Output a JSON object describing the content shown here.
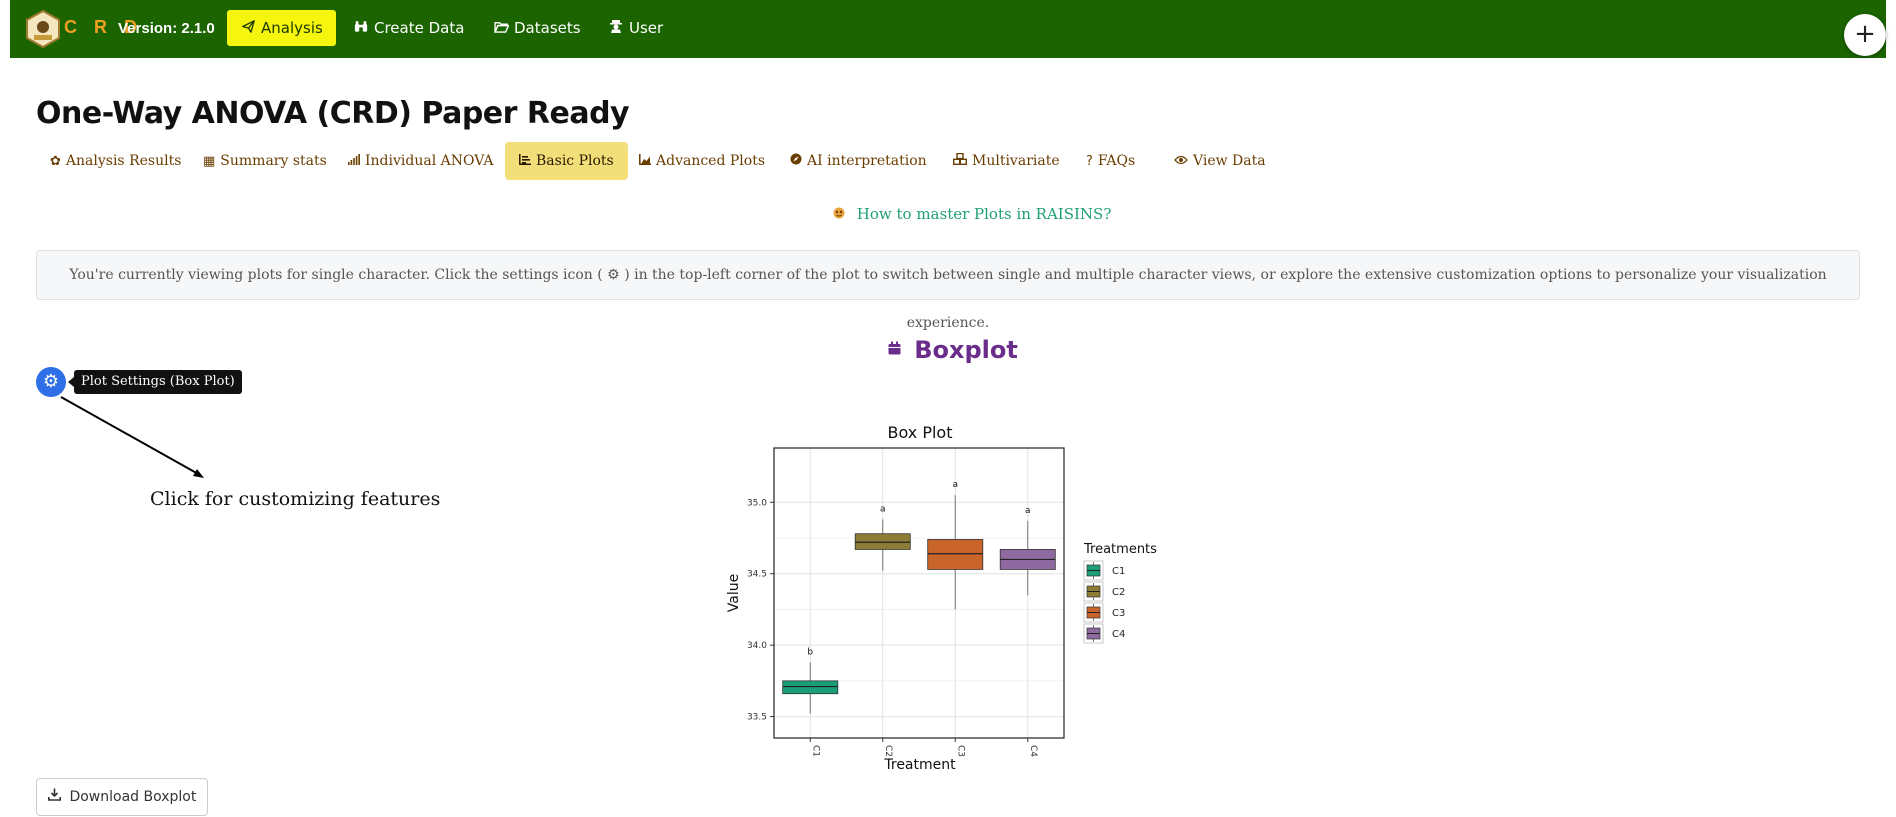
{
  "navbar": {
    "brand": "C R D",
    "version": "Version: 2.1.0",
    "items": [
      {
        "label": "Analysis",
        "icon": "paper-plane-icon"
      },
      {
        "label": "Create Data",
        "icon": "binoculars-icon"
      },
      {
        "label": "Datasets",
        "icon": "folder-open-icon"
      },
      {
        "label": "User",
        "icon": "user-secret-icon"
      }
    ],
    "plus_label": "+"
  },
  "page_title": "One-Way ANOVA (CRD) Paper Ready",
  "tabs": [
    {
      "label": "Analysis Results",
      "icon": "seedling-icon"
    },
    {
      "label": "Summary stats",
      "icon": "table-icon"
    },
    {
      "label": "Individual ANOVA",
      "icon": "signal-icon"
    },
    {
      "label": "Basic Plots",
      "icon": "chart-bar-icon"
    },
    {
      "label": "Advanced Plots",
      "icon": "chart-area-icon"
    },
    {
      "label": "AI interpretation",
      "icon": "compass-icon"
    },
    {
      "label": "Multivariate",
      "icon": "cubes-icon"
    },
    {
      "label": "FAQs",
      "icon": "question-icon"
    },
    {
      "label": "View Data",
      "icon": "eye-icon"
    }
  ],
  "help_link": "How to master Plots in RAISINS?",
  "info_banner": "You're currently viewing plots for single character. Click the settings icon ( ⚙ ) in the top-left corner of the plot to switch between single and multiple character views, or explore the extensive customization options to personalize your visualization experience.",
  "section_title": "Boxplot",
  "settings_tooltip": "Plot Settings (Box Plot)",
  "annotation": "Click for customizing features",
  "download_label": "Download Boxplot",
  "colors": {
    "navbar": "#1b6400",
    "active_nav": "#f5f50d",
    "active_tab": "#f3df7a",
    "accent_purple": "#6b2d8c",
    "link_green": "#20a070"
  },
  "chart_data": {
    "type": "box",
    "title": "Box Plot",
    "xlabel": "Treatment",
    "ylabel": "Value",
    "ylim": [
      33.35,
      35.38
    ],
    "yticks": [
      33.5,
      34.0,
      34.5,
      35.0
    ],
    "ytick_labels": [
      "33.5",
      "34.0",
      "34.5",
      "35.0"
    ],
    "categories": [
      "C1",
      "C2",
      "C3",
      "C4"
    ],
    "legend_title": "Treatments",
    "legend_position": "right",
    "grid": true,
    "boxes": [
      {
        "name": "C1",
        "min": 33.52,
        "q1": 33.66,
        "median": 33.71,
        "q3": 33.75,
        "max": 33.88,
        "letter": "b",
        "color": "#1b9e77"
      },
      {
        "name": "C2",
        "min": 34.52,
        "q1": 34.67,
        "median": 34.72,
        "q3": 34.78,
        "max": 34.88,
        "letter": "a",
        "color": "#8c7d36"
      },
      {
        "name": "C3",
        "min": 34.25,
        "q1": 34.53,
        "median": 34.64,
        "q3": 34.74,
        "max": 35.05,
        "letter": "a",
        "color": "#c9642b"
      },
      {
        "name": "C4",
        "min": 34.35,
        "q1": 34.53,
        "median": 34.6,
        "q3": 34.67,
        "max": 34.87,
        "letter": "a",
        "color": "#8f6aa0"
      }
    ]
  }
}
